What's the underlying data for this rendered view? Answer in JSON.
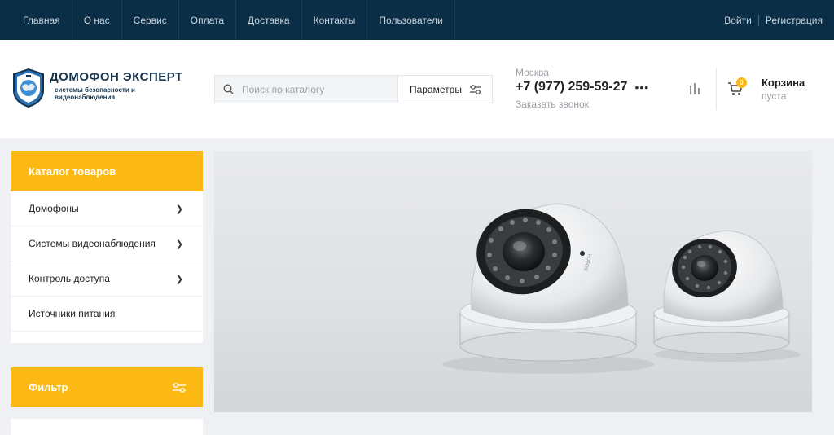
{
  "topnav": {
    "items": [
      "Главная",
      "О нас",
      "Сервис",
      "Оплата",
      "Доставка",
      "Контакты",
      "Пользователи"
    ],
    "login": "Войти",
    "register": "Регистрация"
  },
  "header": {
    "logo_title": "ДОМОФОН ЭКСПЕРТ",
    "logo_sub_1": "системы безопасности и",
    "logo_sub_2": "видеонаблюдения",
    "search_placeholder": "Поиск по каталогу",
    "params_label": "Параметры",
    "city": "Москва",
    "phone": "+7 (977) 259-59-27",
    "callback": "Заказать звонок",
    "cart_title": "Корзина",
    "cart_status": "пуста",
    "cart_count": "0"
  },
  "sidebar": {
    "catalog_title": "Каталог товаров",
    "items": [
      {
        "label": "Домофоны",
        "has_children": true
      },
      {
        "label": "Системы видеонаблюдения",
        "has_children": true
      },
      {
        "label": "Контроль доступа",
        "has_children": true
      },
      {
        "label": "Источники питания",
        "has_children": false
      }
    ],
    "filter_title": "Фильтр"
  },
  "colors": {
    "topnav_bg": "#0b2e47",
    "accent": "#fdb913",
    "brand": "#17344d"
  },
  "icons": {
    "search": "search-icon",
    "params": "sliders-icon",
    "compare": "compare-icon",
    "cart": "cart-icon",
    "chevron": "chevron-right-icon",
    "filter": "filter-icon",
    "menu_dots": "more-dots-icon"
  }
}
